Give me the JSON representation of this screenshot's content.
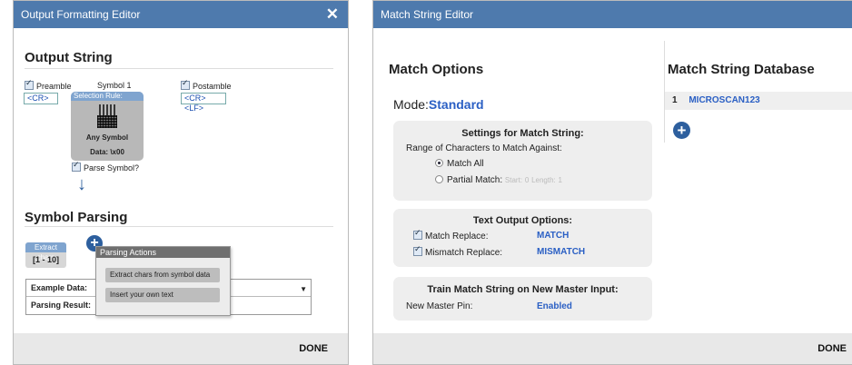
{
  "left_dialog": {
    "title": "Output Formatting Editor",
    "close_label": "✕",
    "output_string": {
      "heading": "Output String",
      "preamble_label": "Preamble",
      "preamble_value": "<CR>",
      "preamble_checked": true,
      "symbol_label": "Symbol 1",
      "postamble_label": "Postamble",
      "postamble_value": "<CR><LF>",
      "postamble_checked": true,
      "selection_rule_label": "Selection Rule:",
      "symbol_name": "Any Symbol",
      "symbol_data": "Data: \\x00",
      "parse_symbol_label": "Parse Symbol?",
      "parse_symbol_checked": true
    },
    "symbol_parsing": {
      "heading": "Symbol Parsing",
      "chip_label": "Extract chars",
      "chip_range": "[1 - 10]",
      "example_data_label": "Example Data:",
      "parsing_result_label": "Parsing Result:"
    },
    "parsing_actions_popup": {
      "title": "Parsing Actions",
      "items": [
        "Extract chars from symbol data",
        "Insert your own text"
      ]
    },
    "done_label": "DONE"
  },
  "right_dialog": {
    "title": "Match String Editor",
    "match_options": {
      "heading": "Match Options",
      "mode_label": "Mode:",
      "mode_value": "Standard",
      "settings_panel": {
        "title": "Settings for Match String:",
        "range_label": "Range of Characters to Match Against:",
        "option_all": "Match All",
        "option_partial": "Partial Match:",
        "start_label": "Start:",
        "start_value": "0",
        "length_label": "Length:",
        "length_value": "1",
        "selected": "Match All"
      },
      "text_output_panel": {
        "title": "Text Output Options:",
        "match_replace_label": "Match Replace:",
        "match_replace_value": "MATCH",
        "mismatch_replace_label": "Mismatch Replace:",
        "mismatch_replace_value": "MISMATCH"
      },
      "train_panel": {
        "title": "Train Match String on New Master Input:",
        "pin_label": "New Master Pin:",
        "pin_value": "Enabled"
      }
    },
    "database": {
      "heading": "Match String Database",
      "rows": [
        {
          "index": "1",
          "value": "MICROSCAN123"
        }
      ]
    },
    "done_label": "DONE"
  }
}
